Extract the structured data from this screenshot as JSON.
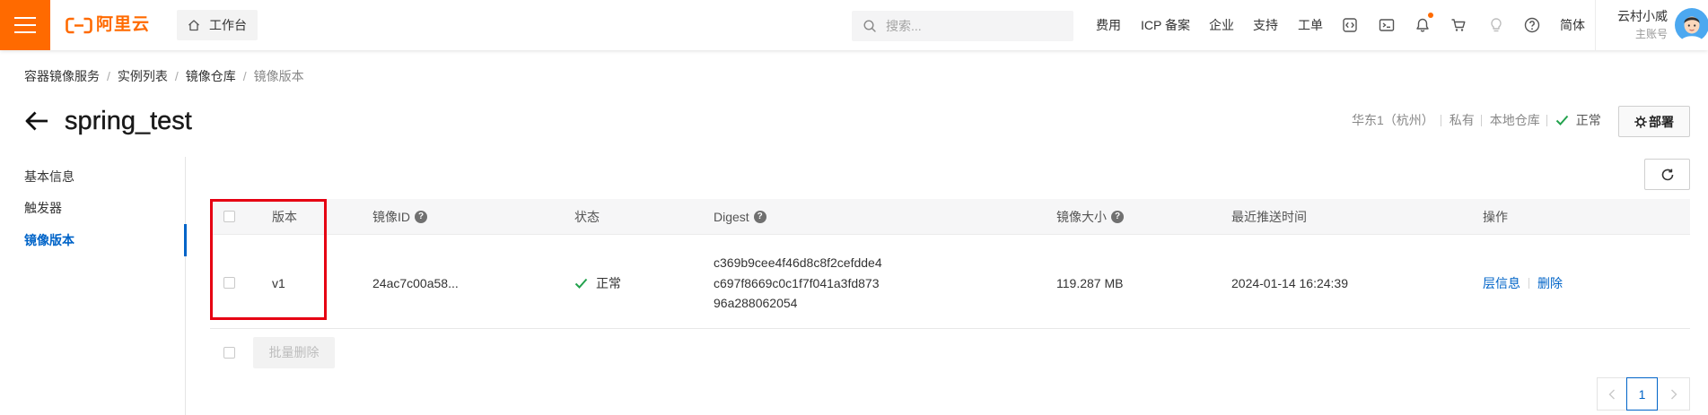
{
  "topbar": {
    "brand_color": "#ff6a00",
    "logo_text": "阿里云",
    "workbench_label": "工作台",
    "search_placeholder": "搜索...",
    "nav": [
      "费用",
      "ICP 备案",
      "企业",
      "支持",
      "工单"
    ],
    "icons": [
      "cloud-shell-icon",
      "terminal-icon",
      "bell-icon",
      "cart-icon",
      "bulb-icon",
      "help-icon"
    ],
    "lang_label": "简体",
    "user_name": "云村小威",
    "user_role": "主账号"
  },
  "breadcrumb": {
    "items": [
      "容器镜像服务",
      "实例列表",
      "镜像仓库",
      "镜像版本"
    ],
    "separator": "/"
  },
  "header": {
    "title": "spring_test",
    "region": "华东1（杭州）",
    "visibility": "私有",
    "repo_type": "本地仓库",
    "status": "正常",
    "deploy_label": "部署"
  },
  "sidebar": {
    "items": [
      {
        "label": "基本信息",
        "active": false
      },
      {
        "label": "触发器",
        "active": false
      },
      {
        "label": "镜像版本",
        "active": true
      }
    ]
  },
  "table": {
    "columns": [
      "版本",
      "镜像ID",
      "状态",
      "Digest",
      "镜像大小",
      "最近推送时间",
      "操作"
    ],
    "rows": [
      {
        "version": "v1",
        "image_id": "24ac7c00a58...",
        "status": "正常",
        "digest_lines": [
          "c369b9cee4f46d8c8f2cefdde4",
          "c697f8669c0c1f7f041a3fd873",
          "96a288062054"
        ],
        "size": "119.287 MB",
        "pushed_at": "2024-01-14 16:24:39",
        "actions": [
          "层信息",
          "删除"
        ]
      }
    ]
  },
  "bulk_delete_label": "批量删除",
  "pagination": {
    "current_page": "1"
  },
  "colors": {
    "link": "#0064c8",
    "success": "#23a24d",
    "highlight": "#e60012",
    "brand": "#ff6a00"
  }
}
